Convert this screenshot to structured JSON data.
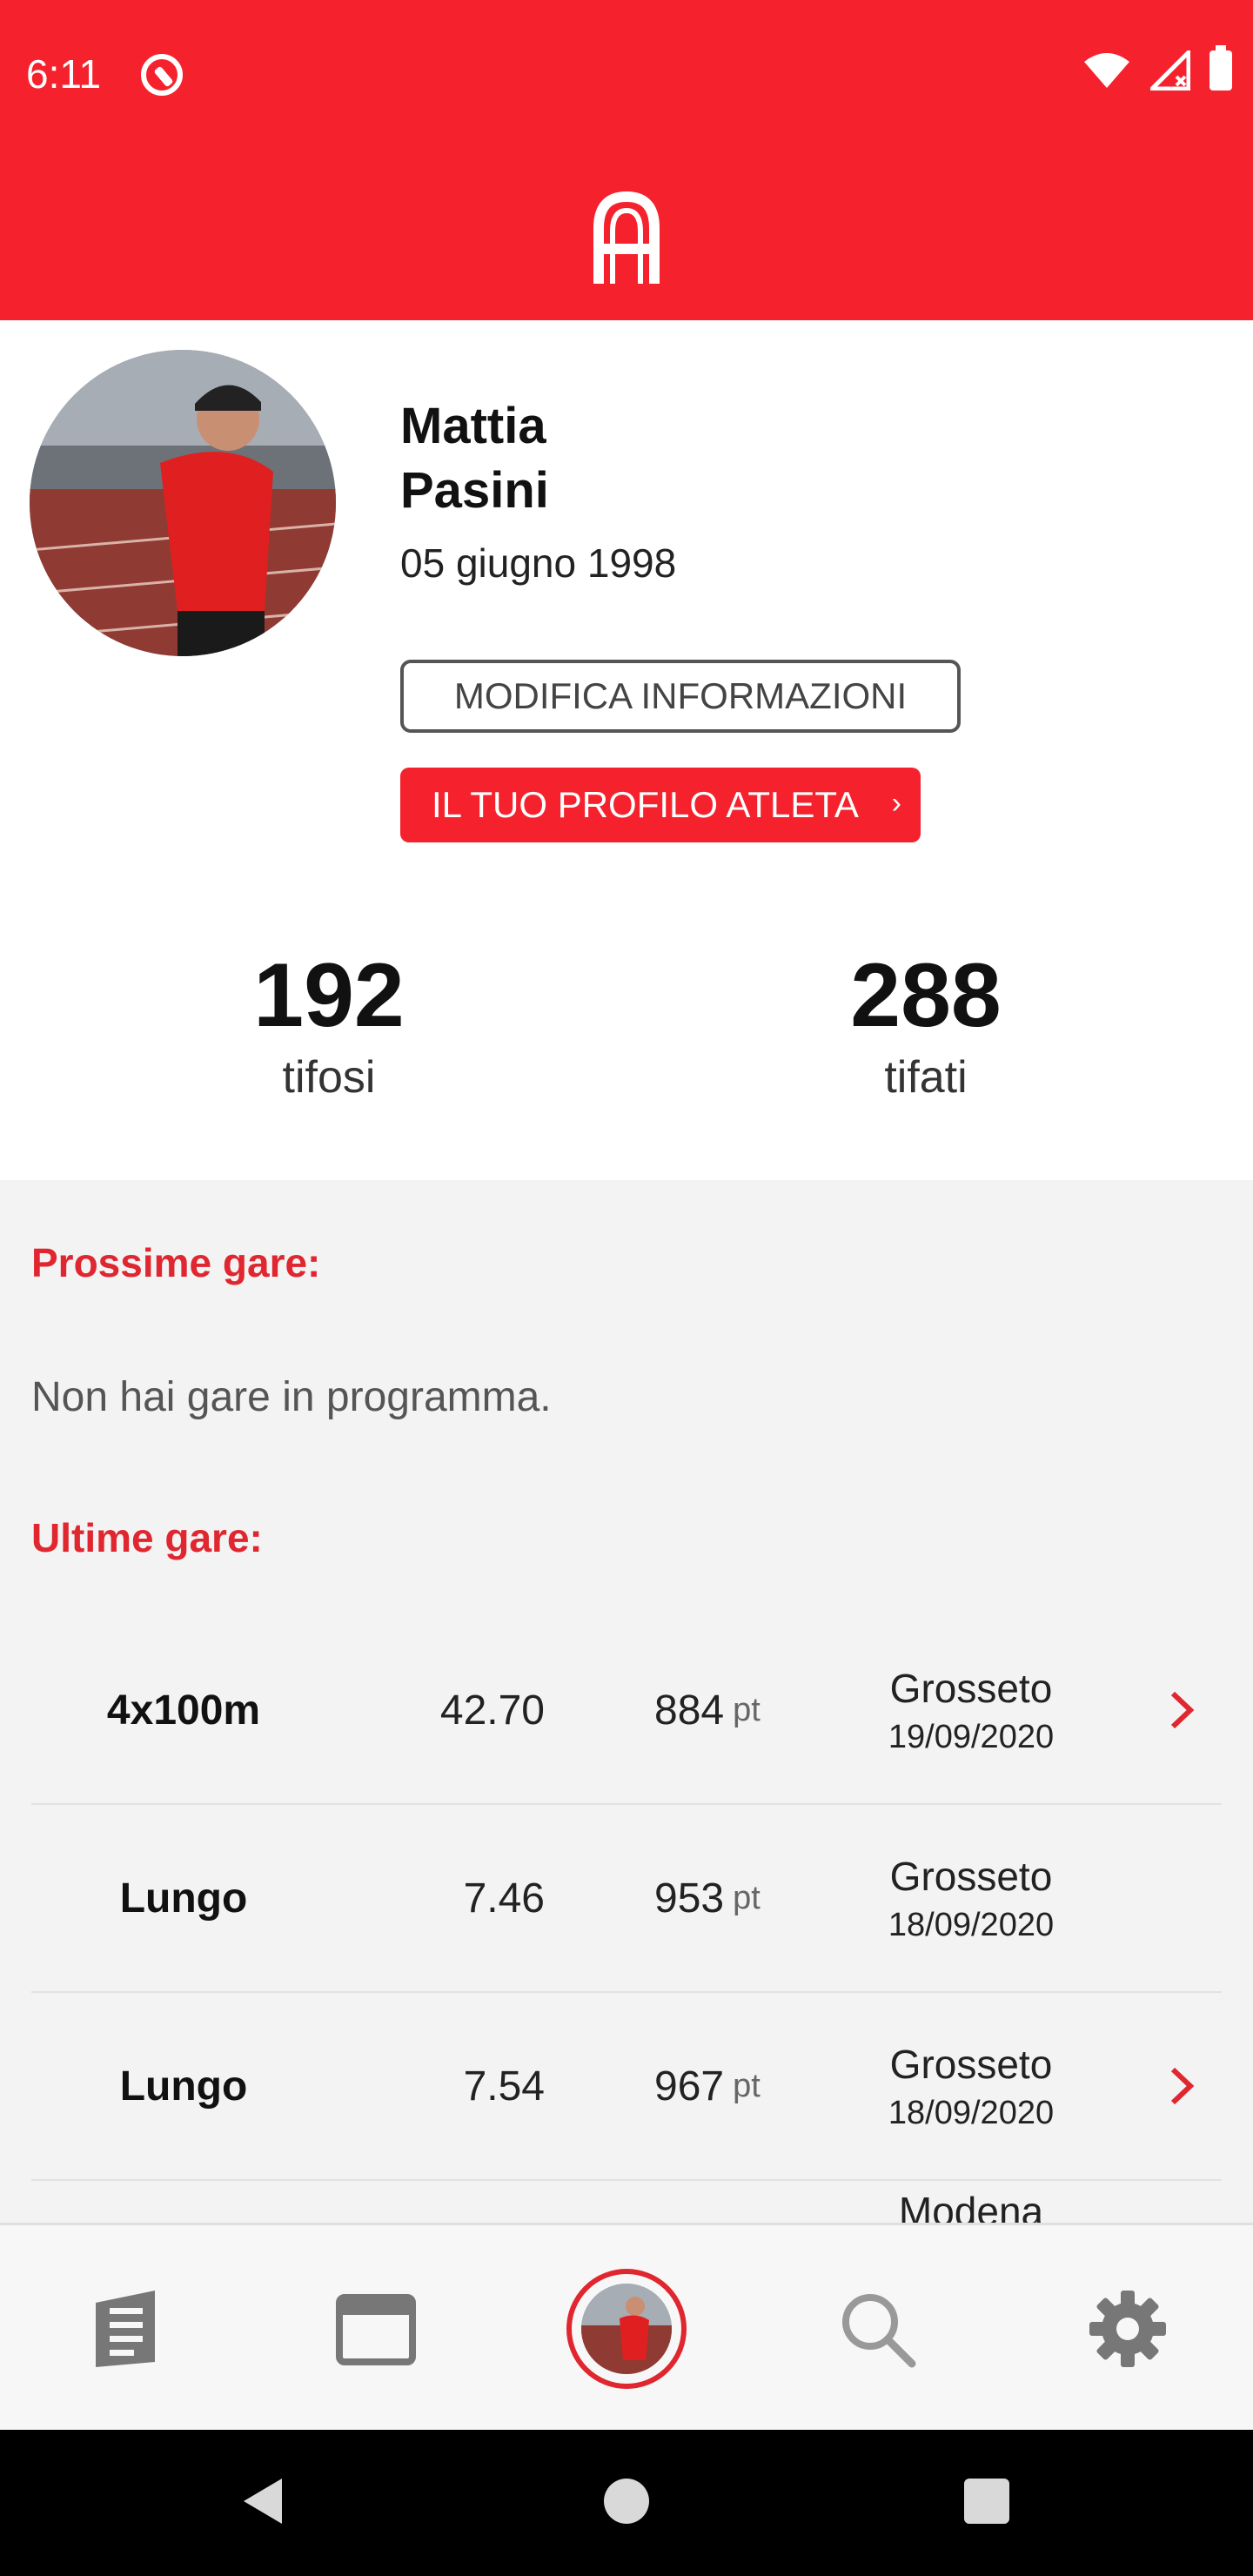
{
  "status_bar": {
    "time": "6:11"
  },
  "profile": {
    "first_name": "Mattia",
    "last_name": "Pasini",
    "birth_date": "05 giugno 1998",
    "edit_button": "MODIFICA INFORMAZIONI",
    "athlete_profile_button": "IL TUO PROFILO ATLETA",
    "athlete_profile_chevron": "›"
  },
  "stats": {
    "fans_count": "192",
    "fans_label": "tifosi",
    "following_count": "288",
    "following_label": "tifati"
  },
  "upcoming": {
    "title": "Prossime gare:",
    "empty_message": "Non hai gare in programma."
  },
  "recent": {
    "title": "Ultime gare:",
    "rows": [
      {
        "event": "4x100m",
        "result": "42.70",
        "points": "884",
        "unit": "pt",
        "city": "Grosseto",
        "date": "19/09/2020",
        "has_arrow": true
      },
      {
        "event": "Lungo",
        "result": "7.46",
        "points": "953",
        "unit": "pt",
        "city": "Grosseto",
        "date": "18/09/2020",
        "has_arrow": false
      },
      {
        "event": "Lungo",
        "result": "7.54",
        "points": "967",
        "unit": "pt",
        "city": "Grosseto",
        "date": "18/09/2020",
        "has_arrow": true
      },
      {
        "event": "",
        "result": "",
        "points": "",
        "unit": "",
        "city": "Modena",
        "date": "",
        "has_arrow": false
      }
    ]
  },
  "colors": {
    "brand_red": "#f5222d",
    "section_title_red": "#e0262f",
    "content_bg": "#f3f3f3"
  },
  "icons": {
    "nav_news": "news-icon",
    "nav_calendar": "calendar-icon",
    "nav_profile": "profile-avatar",
    "nav_search": "search-icon",
    "nav_settings": "gear-icon"
  }
}
